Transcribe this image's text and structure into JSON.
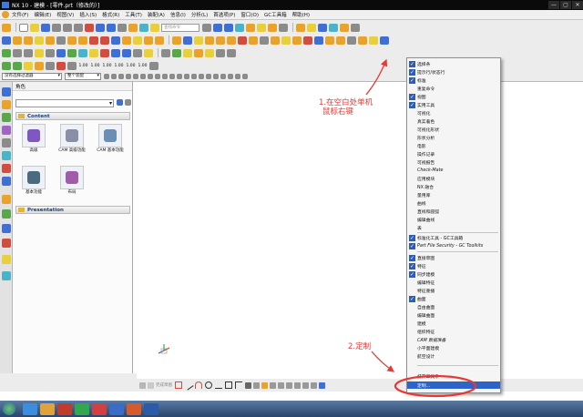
{
  "window": {
    "title": "NX 10 - 建模 - [零件.prt（修改的）]",
    "controls": [
      "—",
      "▢",
      "✕"
    ]
  },
  "menubar": {
    "items": [
      "文件(F)",
      "编辑(E)",
      "视图(V)",
      "插入(S)",
      "格式(R)",
      "工具(T)",
      "装配(A)",
      "信息(I)",
      "分析(L)",
      "首选项(P)",
      "窗口(O)",
      "GC工具箱",
      "帮助(H)"
    ]
  },
  "toolbar": {
    "search_placeholder": "查找命令",
    "number_buttons": [
      "1.00",
      "1.00",
      "1.00",
      "1.00",
      "1.00",
      "1.00"
    ]
  },
  "selection_bar": {
    "filter": "没有选择过滤器",
    "scope": "整个装配"
  },
  "nav_panel": {
    "title": "角色",
    "sections": [
      {
        "label": "Content",
        "tiles": [
          "高级",
          "CAM 高级功能",
          "CAM 基本功能",
          "基本功能",
          "布局"
        ]
      },
      {
        "label": "Presentation",
        "tiles": []
      }
    ]
  },
  "bottom_toolbar": {
    "label": "完成草图"
  },
  "context_menu": {
    "items": [
      {
        "label": "选择条",
        "checked": true
      },
      {
        "label": "提示行/状态行",
        "checked": true
      },
      {
        "label": "标准",
        "checked": true
      },
      {
        "label": "重复命令",
        "checked": false
      },
      {
        "label": "视图",
        "checked": true
      },
      {
        "label": "实用工具",
        "checked": true
      },
      {
        "label": "可视化",
        "checked": false
      },
      {
        "label": "真实着色",
        "checked": false
      },
      {
        "label": "可视化形状",
        "checked": false
      },
      {
        "label": "形状分析",
        "checked": false
      },
      {
        "label": "电影",
        "checked": false
      },
      {
        "label": "操作记录",
        "checked": false
      },
      {
        "label": "可视报告",
        "checked": false
      },
      {
        "label": "Check-Mate",
        "checked": false,
        "italic": true
      },
      {
        "label": "应用模块",
        "checked": false
      },
      {
        "label": "NX 融合",
        "checked": false
      },
      {
        "label": "量用库",
        "checked": false
      },
      {
        "label": "曲线",
        "checked": false
      },
      {
        "label": "直线和圆弧",
        "checked": false
      },
      {
        "label": "编辑曲线",
        "checked": false
      },
      {
        "label": "表",
        "checked": false
      },
      {
        "label": "标准化工具 - GC工具箱",
        "checked": true
      },
      {
        "label": "Part File Security - GC Toolkits",
        "checked": true,
        "italic": true
      },
      {
        "label": "直接草图",
        "checked": true
      },
      {
        "label": "特征",
        "checked": true
      },
      {
        "label": "同步建模",
        "checked": true
      },
      {
        "label": "编辑特征",
        "checked": false
      },
      {
        "label": "特征重播",
        "checked": false
      },
      {
        "label": "曲面",
        "checked": true
      },
      {
        "label": "自由曲面",
        "checked": false
      },
      {
        "label": "编辑曲面",
        "checked": false
      },
      {
        "label": "建模",
        "checked": false
      },
      {
        "label": "组织特征",
        "checked": false
      },
      {
        "label": "CAM 数据准备",
        "checked": false,
        "italic": true
      },
      {
        "label": "小平面建模",
        "checked": false
      },
      {
        "label": "航空设计",
        "checked": false
      },
      {
        "label": "打开工具条",
        "checked": false
      },
      {
        "label": "定制...",
        "checked": false,
        "highlighted": true
      }
    ]
  },
  "annotations": {
    "note1_line1": "1.在空白处单机",
    "note1_line2": "鼠标右键",
    "note2": "2.定制"
  },
  "colors": {
    "annotation": "#e53935",
    "menu_highlight": "#2c64c9",
    "check": "#2f5db6"
  }
}
